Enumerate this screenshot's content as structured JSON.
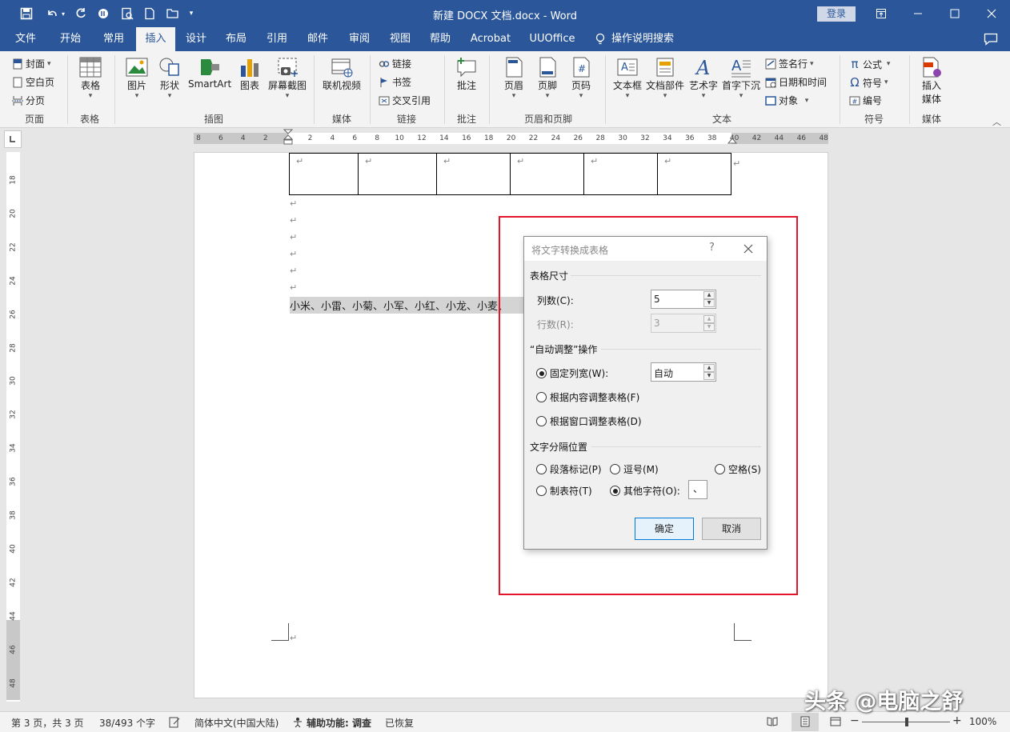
{
  "window": {
    "title": "新建 DOCX 文档.docx  -  Word",
    "login_label": "登录"
  },
  "tabs": [
    {
      "label": "文件"
    },
    {
      "label": "开始"
    },
    {
      "label": "常用"
    },
    {
      "label": "插入"
    },
    {
      "label": "设计"
    },
    {
      "label": "布局"
    },
    {
      "label": "引用"
    },
    {
      "label": "邮件"
    },
    {
      "label": "审阅"
    },
    {
      "label": "视图"
    },
    {
      "label": "帮助"
    },
    {
      "label": "Acrobat"
    },
    {
      "label": "UUOffice"
    },
    {
      "label": "操作说明搜索"
    }
  ],
  "ribbon": {
    "pages": {
      "cover": "封面",
      "blank": "空白页",
      "break": "分页",
      "group": "页面"
    },
    "table": {
      "label": "表格",
      "group": "表格"
    },
    "illustrations": {
      "picture": "图片",
      "shapes": "形状",
      "smartart": "SmartArt",
      "chart": "图表",
      "screenshot": "屏幕截图",
      "group": "插图"
    },
    "media": {
      "online_video": "联机视频",
      "group": "媒体"
    },
    "links": {
      "link": "链接",
      "bookmark": "书签",
      "cross_ref": "交叉引用",
      "group": "链接"
    },
    "comments": {
      "comment": "批注",
      "group": "批注"
    },
    "header_footer": {
      "header": "页眉",
      "footer": "页脚",
      "page_number": "页码",
      "group": "页眉和页脚"
    },
    "text": {
      "textbox": "文本框",
      "quick_parts": "文档部件",
      "wordart": "艺术字",
      "dropcap": "首字下沉",
      "signature": "签名行",
      "datetime": "日期和时间",
      "object": "对象",
      "group": "文本"
    },
    "symbols": {
      "equation": "公式",
      "symbol": "符号",
      "numbering": "编号",
      "group": "符号"
    },
    "media2": {
      "insert_media": "插入",
      "insert_media2": "媒体",
      "group": "媒体"
    }
  },
  "hruler_ticks": [
    "8",
    "6",
    "4",
    "2",
    "2",
    "4",
    "6",
    "8",
    "10",
    "12",
    "14",
    "16",
    "18",
    "20",
    "22",
    "24",
    "26",
    "28",
    "30",
    "32",
    "34",
    "36",
    "38",
    "40",
    "42",
    "44",
    "46",
    "48"
  ],
  "vruler_ticks": [
    "18",
    "20",
    "22",
    "24",
    "26",
    "28",
    "30",
    "32",
    "34",
    "36",
    "38",
    "40",
    "42",
    "44",
    "46",
    "48"
  ],
  "document": {
    "table_cells": [
      "↵",
      "↵",
      "↵",
      "↵",
      "↵",
      "↵"
    ],
    "row_end_mark": "↵",
    "paragraph_marks": [
      "↵",
      "↵",
      "↵",
      "↵",
      "↵",
      "↵"
    ],
    "selected_text": "小米、小雷、小菊、小军、小红、小龙、小麦、",
    "footer_mark": "↵"
  },
  "dialog": {
    "title": "将文字转换成表格",
    "help": "?",
    "size_section": "表格尺寸",
    "columns_label": "列数(C):",
    "columns_value": "5",
    "rows_label": "行数(R):",
    "rows_value": "3",
    "autofit_section": "“自动调整”操作",
    "fixed_width_label": "固定列宽(W):",
    "fixed_width_value": "自动",
    "autofit_content_label": "根据内容调整表格(F)",
    "autofit_window_label": "根据窗口调整表格(D)",
    "separator_section": "文字分隔位置",
    "sep_paragraph": "段落标记(P)",
    "sep_comma": "逗号(M)",
    "sep_space": "空格(S)",
    "sep_tab": "制表符(T)",
    "sep_other": "其他字符(O):",
    "sep_other_value": "、",
    "ok_label": "确定",
    "cancel_label": "取消"
  },
  "statusbar": {
    "page": "第 3 页，共 3 页",
    "words": "38/493 个字",
    "language": "简体中文(中国大陆)",
    "accessibility": "辅助功能: 调查",
    "recovered": "已恢复",
    "zoom_minus": "−",
    "zoom_plus": "+",
    "zoom": "100%"
  },
  "watermark": "头条 @电脑之舒",
  "colors": {
    "title_bar": "#2b579a",
    "highlight_box": "#e3152b",
    "ribbon": "#f3f3f3"
  }
}
